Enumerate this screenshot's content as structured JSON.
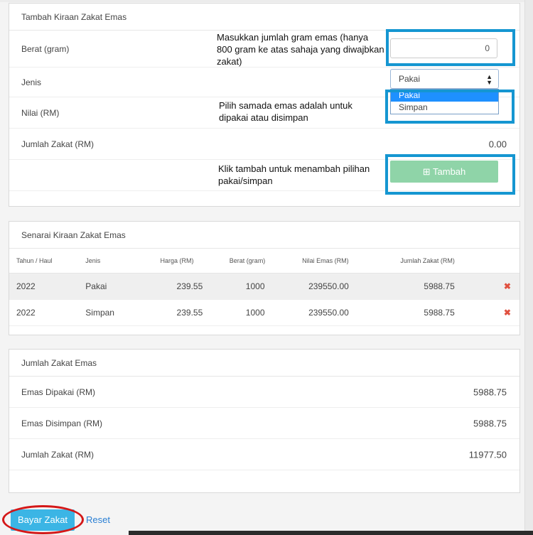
{
  "form": {
    "title": "Tambah Kiraan Zakat Emas",
    "weight_label": "Berat (gram)",
    "weight_value": "0",
    "type_label": "Jenis",
    "type_selected": "Pakai",
    "type_options": [
      "Pakai",
      "Simpan"
    ],
    "value_label": "Nilai (RM)",
    "total_label": "Jumlah Zakat (RM)",
    "total_value": "0.00",
    "add_button_label": "Tambah",
    "add_icon": "plus-square-icon"
  },
  "annotations": {
    "weight_note": "Masukkan jumlah gram emas (hanya 800 gram ke atas sahaja yang diwajbkan zakat)",
    "type_note": "Pilih samada emas adalah untuk dipakai atau disimpan",
    "add_note": "Klik tambah untuk menambah pilihan pakai/simpan",
    "callout_color": "#1596d1"
  },
  "list": {
    "title": "Senarai Kiraan Zakat Emas",
    "columns": [
      "Tahun / Haul",
      "Jenis",
      "Harga (RM)",
      "Berat (gram)",
      "Nilai Emas (RM)",
      "Jumlah Zakat (RM)"
    ],
    "rows": [
      {
        "year": "2022",
        "type": "Pakai",
        "price": "239.55",
        "weight": "1000",
        "gold_value": "239550.00",
        "zakat": "5988.75"
      },
      {
        "year": "2022",
        "type": "Simpan",
        "price": "239.55",
        "weight": "1000",
        "gold_value": "239550.00",
        "zakat": "5988.75"
      }
    ],
    "delete_glyph": "✖",
    "delete_color": "#e0503f"
  },
  "summary": {
    "title": "Jumlah Zakat Emas",
    "worn_label": "Emas Dipakai (RM)",
    "worn_value": "5988.75",
    "kept_label": "Emas Disimpan (RM)",
    "kept_value": "5988.75",
    "total_label": "Jumlah Zakat (RM)",
    "total_value": "11977.50"
  },
  "actions": {
    "pay_label": "Bayar Zakat",
    "reset_label": "Reset",
    "pay_color": "#3bb5e5",
    "highlight_color": "#d41818"
  }
}
